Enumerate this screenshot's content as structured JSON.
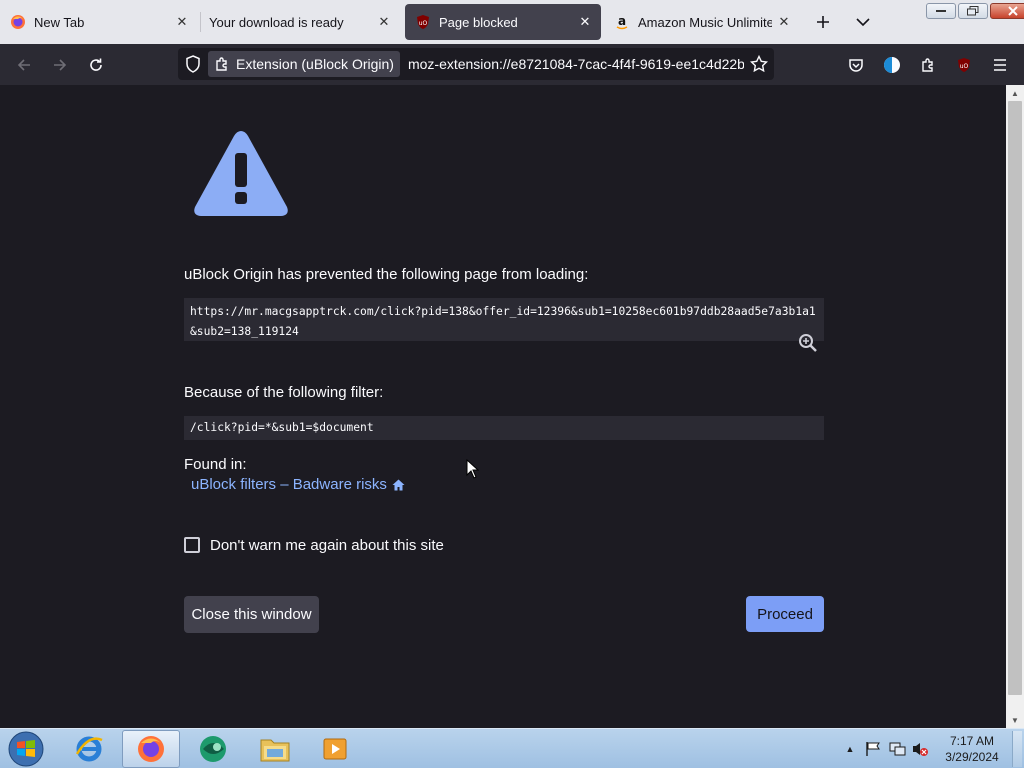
{
  "browser": {
    "tabs": [
      {
        "title": "New Tab",
        "favicon": "firefox-icon",
        "active": false
      },
      {
        "title": "Your download is ready",
        "favicon": "",
        "active": false
      },
      {
        "title": "Page blocked",
        "favicon": "ublock-icon",
        "active": true
      },
      {
        "title": "Amazon Music Unlimited |",
        "favicon": "amazon-icon",
        "active": false
      }
    ],
    "tab_close_glyph": "✕",
    "urlbar": {
      "identity_label": "Extension (uBlock Origin)",
      "url": "moz-extension://e8721084-7cac-4f4f-9619-ee1c4d22b"
    },
    "accent": "#7c9ef6"
  },
  "page": {
    "heading": "uBlock Origin has prevented the following page from loading:",
    "blocked_url": "https://mr.macgsapptrck.com/click?pid=138&offer_id=12396&sub1=10258ec601b97ddb28aad5e7a3b1a1&sub2=138_119124",
    "filter_label": "Because of the following filter:",
    "filter": "/click?pid=*&sub1=$document",
    "found_in_label": "Found in:",
    "found_in_list": "uBlock filters – Badware risks",
    "dont_warn_label": "Don't warn me again about this site",
    "close_button": "Close this window",
    "proceed_button": "Proceed"
  },
  "taskbar": {
    "clock_time": "7:17 AM",
    "clock_date": "3/29/2024",
    "apps": [
      "internet-explorer",
      "firefox",
      "app-green",
      "windows-explorer",
      "media-player"
    ]
  }
}
